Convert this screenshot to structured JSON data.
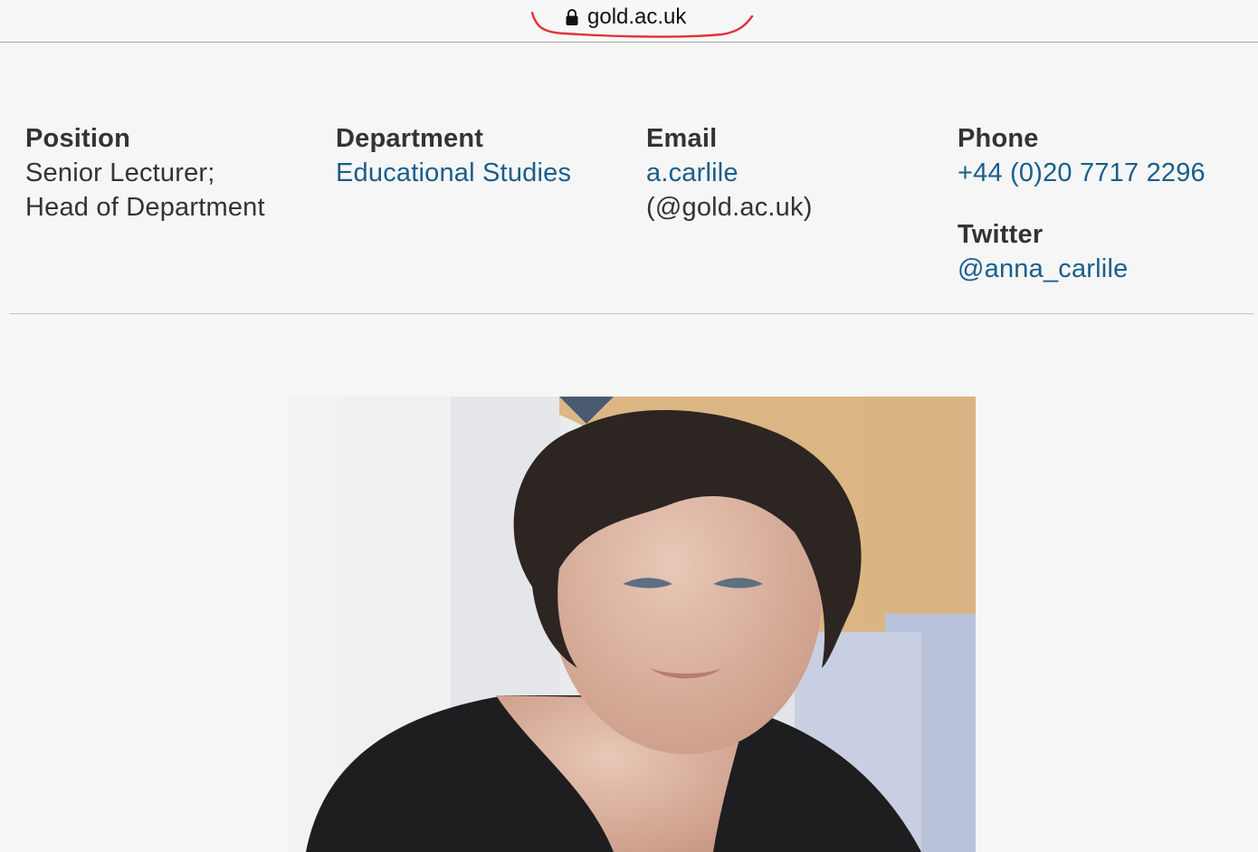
{
  "browser": {
    "url": "gold.ac.uk"
  },
  "profile": {
    "position": {
      "label": "Position",
      "lines": [
        "Senior Lecturer;",
        "Head of Department"
      ]
    },
    "department": {
      "label": "Department",
      "value": "Educational Studies"
    },
    "email": {
      "label": "Email",
      "user": "a.carlile",
      "domain": "(@gold.ac.uk)"
    },
    "phone": {
      "label": "Phone",
      "value": "+44 (0)20 7717 2296"
    },
    "twitter": {
      "label": "Twitter",
      "value": "@anna_carlile"
    }
  },
  "colors": {
    "link": "#1a5e8c",
    "text": "#333333",
    "annotation": "#e0323a"
  },
  "icons": [
    "lock-icon"
  ]
}
